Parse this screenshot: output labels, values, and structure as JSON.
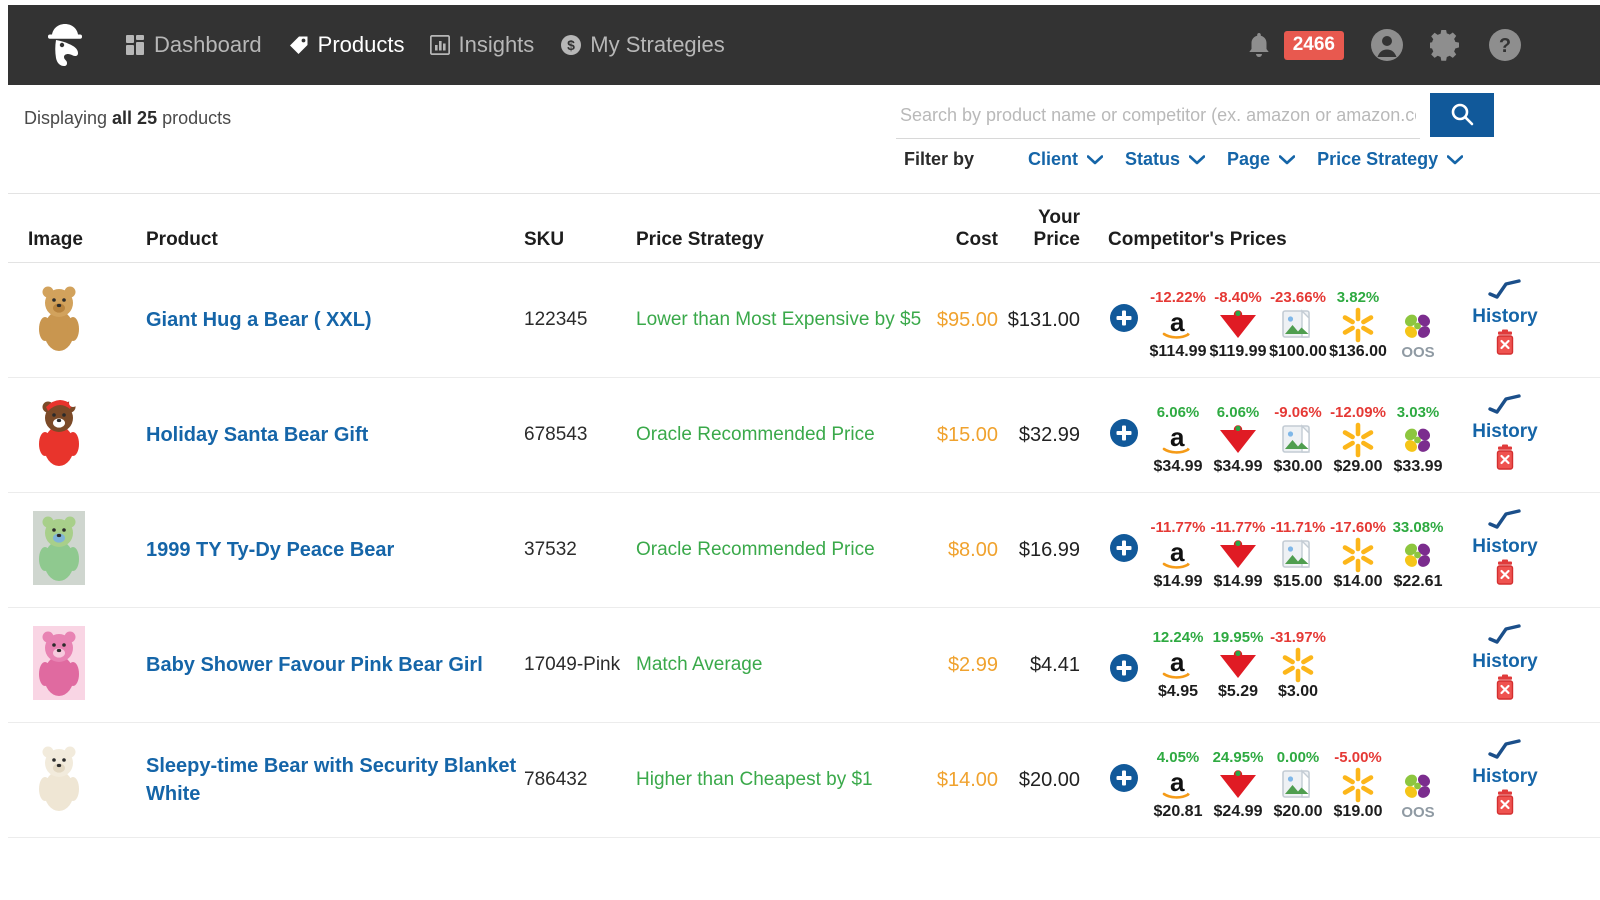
{
  "nav": {
    "logo_icon": "hardhat-mascot-logo",
    "items": [
      {
        "label": "Dashboard",
        "icon": "dashboard-grid-icon",
        "active": false
      },
      {
        "label": "Products",
        "icon": "tag-icon",
        "active": true
      },
      {
        "label": "Insights",
        "icon": "bar-chart-icon",
        "active": false
      },
      {
        "label": "My Strategies",
        "icon": "dollar-circle-icon",
        "active": false
      }
    ],
    "notification_count": "2466",
    "right_icons": [
      "bell-icon",
      "account-circle-icon",
      "gear-icon",
      "help-circle-icon"
    ],
    "badge_color": "#e8594f"
  },
  "toolbar": {
    "displaying_prefix": "Displaying ",
    "displaying_strong": "all 25",
    "displaying_suffix": " products",
    "search_placeholder": "Search by product name or competitor (ex. amazon or amazon.com)",
    "search_value": "",
    "search_button_icon": "search-icon",
    "search_button_color": "#11599a",
    "filter_label": "Filter by",
    "filters": [
      {
        "label": "Client"
      },
      {
        "label": "Status"
      },
      {
        "label": "Page"
      },
      {
        "label": "Price Strategy"
      }
    ]
  },
  "table": {
    "headers": {
      "image": "Image",
      "product": "Product",
      "sku": "SKU",
      "strategy": "Price Strategy",
      "cost": "Cost",
      "your_price_l1": "Your",
      "your_price_l2": "Price",
      "competitors": "Competitor's Prices",
      "history": ""
    },
    "history_label": "History",
    "add_competitor_icon": "add-circle-icon",
    "history_icon": "line-chart-icon",
    "delete_icon": "delete-trash-icon",
    "rows": [
      {
        "image_icon": "teddy-bear-tan-photo",
        "name": "Giant Hug a Bear ( XXL)",
        "sku": "122345",
        "strategy": "Lower than Most Expensive by $5",
        "cost": "$95.00",
        "your_price": "$131.00",
        "competitors": [
          {
            "site": "amazon",
            "pct": "-12.22%",
            "dir": "down",
            "price": "$114.99",
            "stagger": false
          },
          {
            "site": "target",
            "pct": "-8.40%",
            "dir": "down",
            "price": "$119.99",
            "stagger": false
          },
          {
            "site": "broken-image",
            "pct": "-23.66%",
            "dir": "down",
            "price": "$100.00",
            "stagger": true
          },
          {
            "site": "walmart",
            "pct": "3.82%",
            "dir": "up",
            "price": "$136.00",
            "stagger": false
          },
          {
            "site": "zulily",
            "pct": "",
            "dir": "none",
            "price": "OOS",
            "stagger": false
          }
        ]
      },
      {
        "image_icon": "teddy-bear-santa-photo",
        "name": "Holiday Santa Bear Gift",
        "sku": "678543",
        "strategy": "Oracle Recommended Price",
        "cost": "$15.00",
        "your_price": "$32.99",
        "competitors": [
          {
            "site": "amazon",
            "pct": "6.06%",
            "dir": "up",
            "price": "$34.99",
            "stagger": false
          },
          {
            "site": "target",
            "pct": "6.06%",
            "dir": "up",
            "price": "$34.99",
            "stagger": false
          },
          {
            "site": "broken-image",
            "pct": "-9.06%",
            "dir": "down",
            "price": "$30.00",
            "stagger": true
          },
          {
            "site": "walmart",
            "pct": "-12.09%",
            "dir": "down",
            "price": "$29.00",
            "stagger": false
          },
          {
            "site": "zulily",
            "pct": "3.03%",
            "dir": "up",
            "price": "$33.99",
            "stagger": false
          }
        ]
      },
      {
        "image_icon": "teddy-bear-tiedye-photo",
        "name": "1999 TY Ty-Dy Peace Bear",
        "sku": "37532",
        "strategy": "Oracle Recommended Price",
        "cost": "$8.00",
        "your_price": "$16.99",
        "competitors": [
          {
            "site": "amazon",
            "pct": "-11.77%",
            "dir": "down",
            "price": "$14.99",
            "stagger": false
          },
          {
            "site": "target",
            "pct": "-11.77%",
            "dir": "down",
            "price": "$14.99",
            "stagger": false
          },
          {
            "site": "broken-image",
            "pct": "-11.71%",
            "dir": "down",
            "price": "$15.00",
            "stagger": true
          },
          {
            "site": "walmart",
            "pct": "-17.60%",
            "dir": "down",
            "price": "$14.00",
            "stagger": false
          },
          {
            "site": "zulily",
            "pct": "33.08%",
            "dir": "up",
            "price": "$22.61",
            "stagger": false
          }
        ]
      },
      {
        "image_icon": "teddy-bear-pink-boxed-photo",
        "name": "Baby Shower Favour Pink Bear Girl",
        "sku": "17049-Pink",
        "strategy": "Match Average",
        "cost": "$2.99",
        "your_price": "$4.41",
        "competitors": [
          {
            "site": "amazon",
            "pct": "12.24%",
            "dir": "up",
            "price": "$4.95",
            "stagger": false
          },
          {
            "site": "target",
            "pct": "19.95%",
            "dir": "up",
            "price": "$5.29",
            "stagger": false
          },
          {
            "site": "walmart",
            "pct": "-31.97%",
            "dir": "down",
            "price": "$3.00",
            "stagger": false
          }
        ]
      },
      {
        "image_icon": "teddy-bear-cream-blanket-photo",
        "name": "Sleepy-time Bear with Security Blanket White",
        "sku": "786432",
        "strategy": "Higher than Cheapest by $1",
        "cost": "$14.00",
        "your_price": "$20.00",
        "competitors": [
          {
            "site": "amazon",
            "pct": "4.05%",
            "dir": "up",
            "price": "$20.81",
            "stagger": false
          },
          {
            "site": "target",
            "pct": "24.95%",
            "dir": "up",
            "price": "$24.99",
            "stagger": false
          },
          {
            "site": "broken-image",
            "pct": "0.00%",
            "dir": "up",
            "price": "$20.00",
            "stagger": true
          },
          {
            "site": "walmart",
            "pct": "-5.00%",
            "dir": "down",
            "price": "$19.00",
            "stagger": false
          },
          {
            "site": "zulily",
            "pct": "",
            "dir": "none",
            "price": "OOS",
            "stagger": false
          }
        ]
      }
    ]
  },
  "colors": {
    "nav_bg": "#333333",
    "link_blue": "#1565a8",
    "strategy_green": "#3aa94a",
    "cost_orange": "#f0a22e",
    "pct_up": "#2eaa41",
    "pct_down": "#e53935"
  }
}
